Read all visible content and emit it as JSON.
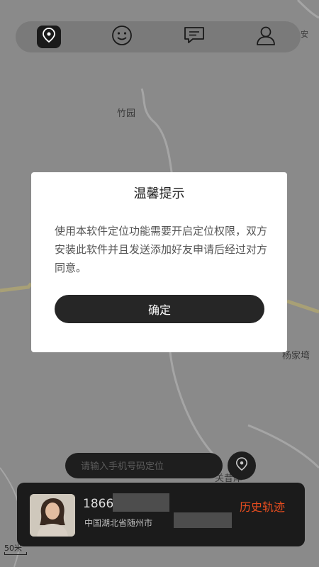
{
  "map": {
    "labels": [
      "竹园",
      "杨家塆",
      "关昔岸",
      "安"
    ],
    "scale": "50米"
  },
  "nav": {
    "items": [
      {
        "name": "location",
        "icon": "location-pin-icon",
        "active": true
      },
      {
        "name": "smile",
        "icon": "smile-face-icon",
        "active": false
      },
      {
        "name": "message",
        "icon": "chat-bubble-icon",
        "active": false
      },
      {
        "name": "profile",
        "icon": "person-icon",
        "active": false
      }
    ]
  },
  "dialog": {
    "title": "温馨提示",
    "body": "使用本软件定位功能需要开启定位权限，双方安装此软件并且发送添加好友申请后经过对方同意。",
    "confirm": "确定"
  },
  "search": {
    "placeholder": "请输入手机号码定位",
    "value": ""
  },
  "card": {
    "phone": "1866",
    "address": "中国湖北省随州市",
    "history": "历史轨迹",
    "accent": "#e74d1f"
  }
}
